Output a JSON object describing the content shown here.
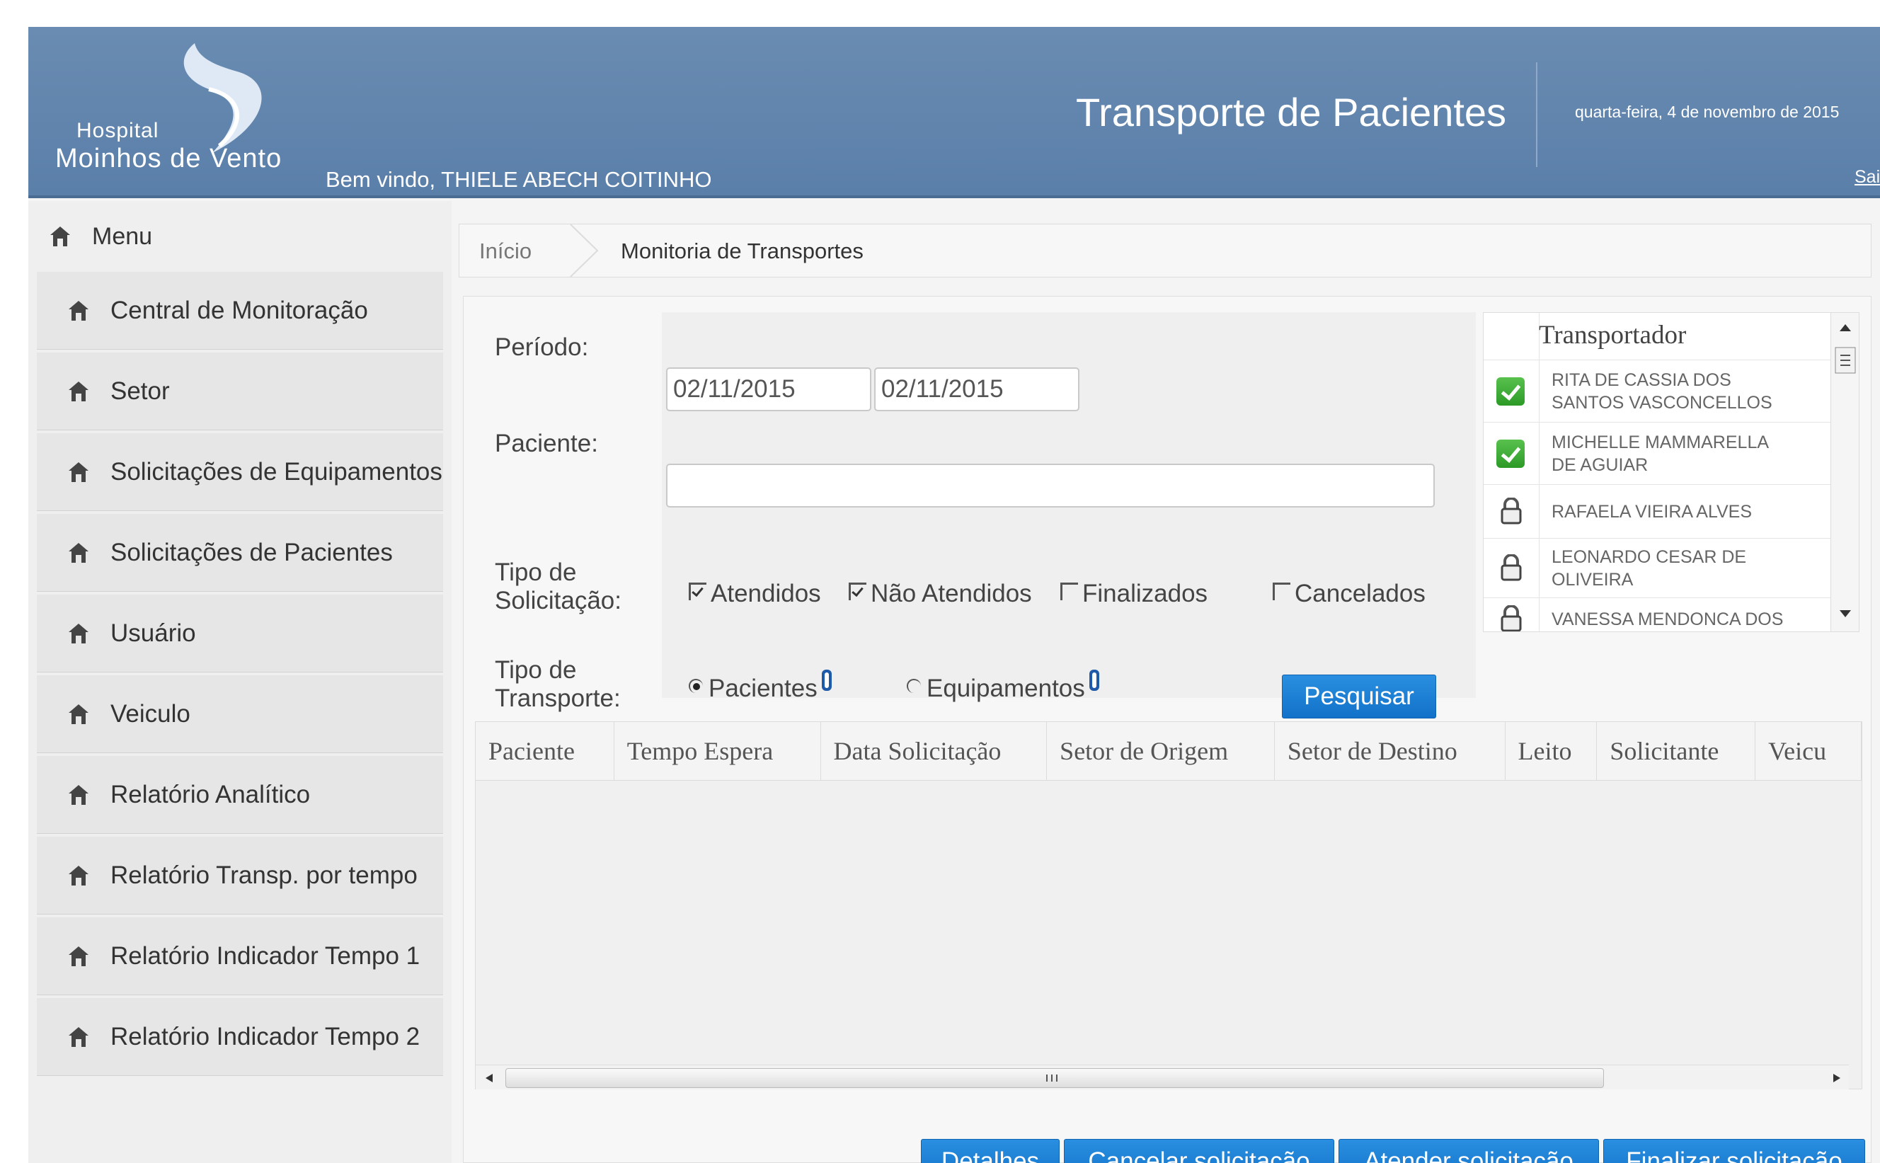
{
  "header": {
    "logo_line1": "Hospital",
    "logo_line2": "Moinhos de Vento",
    "welcome": "Bem vindo, THIELE ABECH COITINHO",
    "app_title": "Transporte de Pacientes",
    "date": "quarta-feira, 4 de novembro de 2015",
    "logout": "Sair"
  },
  "sidebar": {
    "title": "Menu",
    "items": [
      {
        "label": "Central de Monitoração"
      },
      {
        "label": "Setor"
      },
      {
        "label": "Solicitações de Equipamentos"
      },
      {
        "label": "Solicitações de Pacientes"
      },
      {
        "label": "Usuário"
      },
      {
        "label": "Veiculo"
      },
      {
        "label": "Relatório Analítico"
      },
      {
        "label": "Relatório Transp. por tempo"
      },
      {
        "label": "Relatório Indicador Tempo 1"
      },
      {
        "label": "Relatório Indicador Tempo 2"
      }
    ]
  },
  "breadcrumb": {
    "home": "Início",
    "current": "Monitoria de Transportes"
  },
  "filters": {
    "periodo_label": "Período:",
    "date_from": "02/11/2015",
    "date_to": "02/11/2015",
    "paciente_label": "Paciente:",
    "paciente_value": "",
    "tipo_solicitacao_label_1": "Tipo de",
    "tipo_solicitacao_label_2": "Solicitação:",
    "options_solicitacao": [
      {
        "label": "Atendidos",
        "checked": true
      },
      {
        "label": "Não Atendidos",
        "checked": true
      },
      {
        "label": "Finalizados",
        "checked": false
      },
      {
        "label": "Cancelados",
        "checked": false
      }
    ],
    "tipo_transporte_label_1": "Tipo de",
    "tipo_transporte_label_2": "Transporte:",
    "options_transporte": [
      {
        "label": "Pacientes",
        "selected": true
      },
      {
        "label": "Equipamentos",
        "selected": false
      }
    ],
    "search_button": "Pesquisar"
  },
  "transporters": {
    "header": "Transportador",
    "rows": [
      {
        "line1": "RITA DE CASSIA DOS",
        "line2": "SANTOS VASCONCELLOS",
        "status_icon": "check-icon"
      },
      {
        "line1": "MICHELLE MAMMARELLA",
        "line2": "DE AGUIAR",
        "status_icon": "check-icon"
      },
      {
        "line1": "RAFAELA VIEIRA ALVES",
        "line2": "",
        "status_icon": "busy-icon"
      },
      {
        "line1": "LEONARDO CESAR DE",
        "line2": "OLIVEIRA",
        "status_icon": "busy-icon"
      },
      {
        "line1": "VANESSA MENDONCA DOS",
        "line2": "",
        "status_icon": "busy-icon"
      }
    ]
  },
  "table": {
    "columns": [
      "Paciente",
      "Tempo Espera",
      "Data Solicitação",
      "Setor de Origem",
      "Setor de Destino",
      "Leito",
      "Solicitante",
      "Veicu"
    ],
    "rows": []
  },
  "actions": {
    "details": "Detalhes",
    "cancel": "Cancelar solicitação",
    "attend": "Atender solicitação",
    "finish": "Finalizar solicitação"
  },
  "colors": {
    "header_bg": "#5f83ad",
    "accent_button": "#1a7fd6",
    "ok_green": "#3aa832"
  }
}
